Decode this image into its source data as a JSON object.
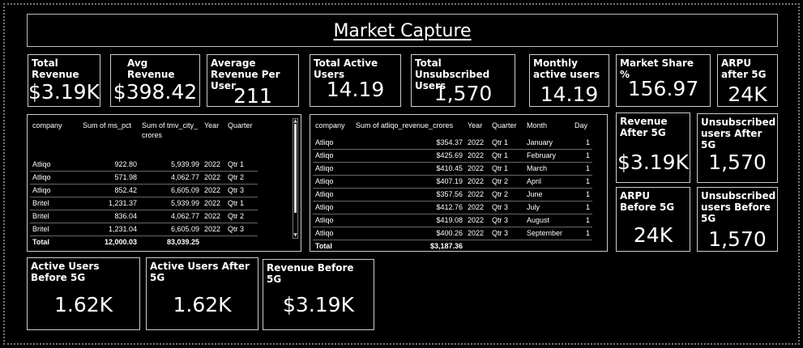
{
  "title": "Market Capture",
  "cards": {
    "total_revenue": {
      "label": "Total Revenue",
      "value": "$3.19K"
    },
    "avg_revenue": {
      "label": "Avg Revenue",
      "value": "$398.42"
    },
    "avg_rev_per_user": {
      "label": "Average Revenue Per User",
      "value": "211"
    },
    "total_active_users": {
      "label": "Total Active Users",
      "value": "14.19"
    },
    "total_unsubscribed": {
      "label": "Total Unsubscribed Users",
      "value": "1,570"
    },
    "monthly_active": {
      "label": "Monthly active users",
      "value": "14.19"
    },
    "market_share": {
      "label": "Market Share %",
      "value": "156.97"
    },
    "arpu_after": {
      "label": "ARPU after 5G",
      "value": "24K"
    },
    "revenue_after": {
      "label": "Revenue After 5G",
      "value": "$3.19K"
    },
    "unsub_after": {
      "label": "Unsubscribed users After 5G",
      "value": "1,570"
    },
    "arpu_before": {
      "label": "ARPU Before 5G",
      "value": "24K"
    },
    "unsub_before": {
      "label": "Unsubscribed users Before 5G",
      "value": "1,570"
    },
    "active_before": {
      "label": "Active Users Before 5G",
      "value": "1.62K"
    },
    "active_after": {
      "label": "Active Users After 5G",
      "value": "1.62K"
    },
    "revenue_before": {
      "label": "Revenue Before 5G",
      "value": "$3.19K"
    }
  },
  "table1": {
    "headers": [
      "company",
      "Sum of ms_pct",
      "Sum of tmv_city_crores",
      "Year",
      "Quarter"
    ],
    "rows": [
      [
        "Atliqo",
        "922.80",
        "5,939.99",
        "2022",
        "Qtr 1"
      ],
      [
        "Atliqo",
        "571.98",
        "4,062.77",
        "2022",
        "Qtr 2"
      ],
      [
        "Atliqo",
        "852.42",
        "6,605.09",
        "2022",
        "Qtr 3"
      ],
      [
        "Britel",
        "1,231.37",
        "5,939.99",
        "2022",
        "Qtr 1"
      ],
      [
        "Britel",
        "836.04",
        "4,062.77",
        "2022",
        "Qtr 2"
      ],
      [
        "Britel",
        "1,231.04",
        "6,605.09",
        "2022",
        "Qtr 3"
      ]
    ],
    "total": [
      "Total",
      "12,000.03",
      "83,039.25",
      "",
      ""
    ]
  },
  "table2": {
    "headers": [
      "company",
      "Sum of atliqo_revenue_crores",
      "Year",
      "Quarter",
      "Month",
      "Day"
    ],
    "rows": [
      [
        "Atliqo",
        "$354.37",
        "2022",
        "Qtr 1",
        "January",
        "1"
      ],
      [
        "Atliqo",
        "$425.69",
        "2022",
        "Qtr 1",
        "February",
        "1"
      ],
      [
        "Atliqo",
        "$410.45",
        "2022",
        "Qtr 1",
        "March",
        "1"
      ],
      [
        "Atliqo",
        "$407.19",
        "2022",
        "Qtr 2",
        "April",
        "1"
      ],
      [
        "Atliqo",
        "$357.56",
        "2022",
        "Qtr 2",
        "June",
        "1"
      ],
      [
        "Atliqo",
        "$412.76",
        "2022",
        "Qtr 3",
        "July",
        "1"
      ],
      [
        "Atliqo",
        "$419.08",
        "2022",
        "Qtr 3",
        "August",
        "1"
      ],
      [
        "Atliqo",
        "$400.26",
        "2022",
        "Qtr 3",
        "September",
        "1"
      ]
    ],
    "total": [
      "Total",
      "$3,187.36",
      "",
      "",
      "",
      ""
    ]
  }
}
